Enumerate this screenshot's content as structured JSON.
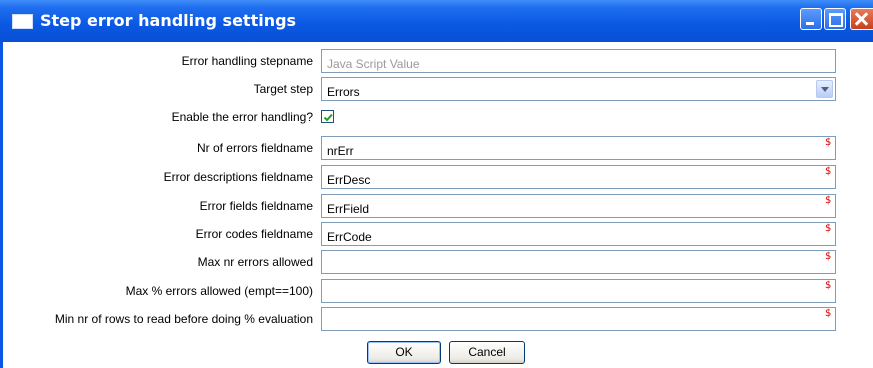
{
  "window": {
    "title": "Step error handling settings"
  },
  "form": {
    "stepname": {
      "label": "Error handling stepname",
      "value": "Java Script Value"
    },
    "target_step": {
      "label": "Target step",
      "value": "Errors"
    },
    "enable": {
      "label": "Enable the error handling?",
      "checked": true
    },
    "nr_errors": {
      "label": "Nr of errors fieldname",
      "value": "nrErr"
    },
    "err_desc": {
      "label": "Error descriptions fieldname",
      "value": "ErrDesc"
    },
    "err_fields": {
      "label": "Error fields fieldname",
      "value": "ErrField"
    },
    "err_codes": {
      "label": "Error codes fieldname",
      "value": "ErrCode"
    },
    "max_errors": {
      "label": "Max nr errors allowed",
      "value": ""
    },
    "max_pct": {
      "label": "Max % errors allowed (empt==100)",
      "value": ""
    },
    "min_rows": {
      "label": "Min nr of rows to read before doing % evaluation",
      "value": ""
    },
    "variable_marker": "$"
  },
  "buttons": {
    "ok": "OK",
    "cancel": "Cancel"
  },
  "colors": {
    "titlebar": "#0a58e2",
    "variable_marker": "#d60000",
    "input_border": "#7f9db9"
  }
}
